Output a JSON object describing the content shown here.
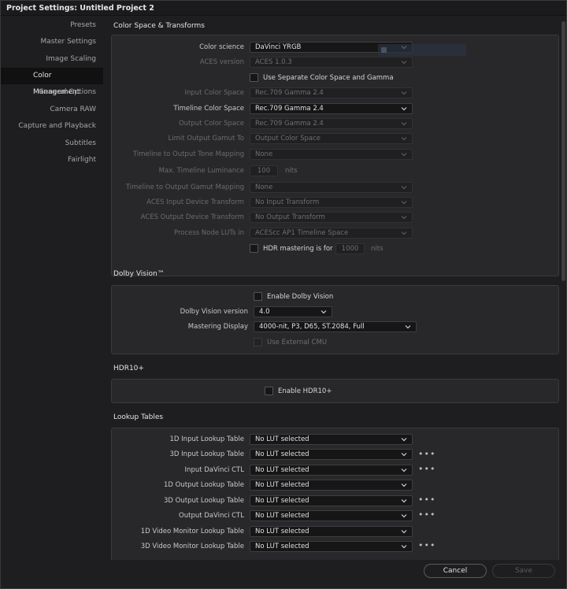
{
  "window": {
    "title": "Project Settings:  Untitled Project 2"
  },
  "sidebar": {
    "items": [
      {
        "label": "Presets"
      },
      {
        "label": "Master Settings"
      },
      {
        "label": "Image Scaling"
      },
      {
        "label": "Color Management",
        "active": true
      },
      {
        "label": "General Options"
      },
      {
        "label": "Camera RAW"
      },
      {
        "label": "Capture and Playback"
      },
      {
        "label": "Subtitles"
      },
      {
        "label": "Fairlight"
      }
    ]
  },
  "color_space": {
    "title": "Color Space & Transforms",
    "color_science": {
      "label": "Color science",
      "value": "DaVinci YRGB"
    },
    "aces_version": {
      "label": "ACES version",
      "value": "ACES 1.0.3"
    },
    "separate_cs": {
      "label": "Use Separate Color Space and Gamma",
      "checked": false
    },
    "input_cs": {
      "label": "Input Color Space",
      "value": "Rec.709 Gamma 2.4"
    },
    "timeline_cs": {
      "label": "Timeline Color Space",
      "value": "Rec.709 Gamma 2.4"
    },
    "output_cs": {
      "label": "Output Color Space",
      "value": "Rec.709 Gamma 2.4"
    },
    "limit_gamut": {
      "label": "Limit Output Gamut To",
      "value": "Output Color Space"
    },
    "tone_mapping": {
      "label": "Timeline to Output Tone Mapping",
      "value": "None"
    },
    "max_luminance": {
      "label": "Max. Timeline Luminance",
      "value": "100",
      "unit": "nits"
    },
    "gamut_mapping": {
      "label": "Timeline to Output Gamut Mapping",
      "value": "None"
    },
    "aces_idt": {
      "label": "ACES Input Device Transform",
      "value": "No Input Transform"
    },
    "aces_odt": {
      "label": "ACES Output Device Transform",
      "value": "No Output Transform"
    },
    "node_luts": {
      "label": "Process Node LUTs in",
      "value": "ACEScc AP1 Timeline Space"
    },
    "hdr_mastering": {
      "label": "HDR mastering is for",
      "value": "1000",
      "unit": "nits",
      "checked": false
    }
  },
  "dolby": {
    "title": "Dolby Vision™",
    "enable": {
      "label": "Enable Dolby Vision",
      "checked": false
    },
    "version": {
      "label": "Dolby Vision version",
      "value": "4.0"
    },
    "mastering": {
      "label": "Mastering Display",
      "value": "4000-nit, P3, D65, ST.2084, Full"
    },
    "external_cmu": {
      "label": "Use External CMU",
      "checked": false
    }
  },
  "hdr10": {
    "title": "HDR10+",
    "enable": {
      "label": "Enable HDR10+",
      "checked": false
    }
  },
  "luts": {
    "title": "Lookup Tables",
    "rows": [
      {
        "label": "1D Input Lookup Table",
        "value": "No LUT selected",
        "more": false
      },
      {
        "label": "3D Input Lookup Table",
        "value": "No LUT selected",
        "more": true
      },
      {
        "label": "Input DaVinci CTL",
        "value": "No LUT selected",
        "more": true
      },
      {
        "label": "1D Output Lookup Table",
        "value": "No LUT selected",
        "more": false
      },
      {
        "label": "3D Output Lookup Table",
        "value": "No LUT selected",
        "more": true
      },
      {
        "label": "Output DaVinci CTL",
        "value": "No LUT selected",
        "more": true
      },
      {
        "label": "1D Video Monitor Lookup Table",
        "value": "No LUT selected",
        "more": false
      },
      {
        "label": "3D Video Monitor Lookup Table",
        "value": "No LUT selected",
        "more": true
      }
    ],
    "more_glyph": "•••"
  },
  "footer": {
    "cancel_label": "Cancel",
    "save_label": "Save"
  },
  "colors": {
    "background": "#1e1e20",
    "panel": "#28282b",
    "active_nav": "#111112",
    "text": "#cfcfcf",
    "dim_text": "#6b6b6e"
  }
}
